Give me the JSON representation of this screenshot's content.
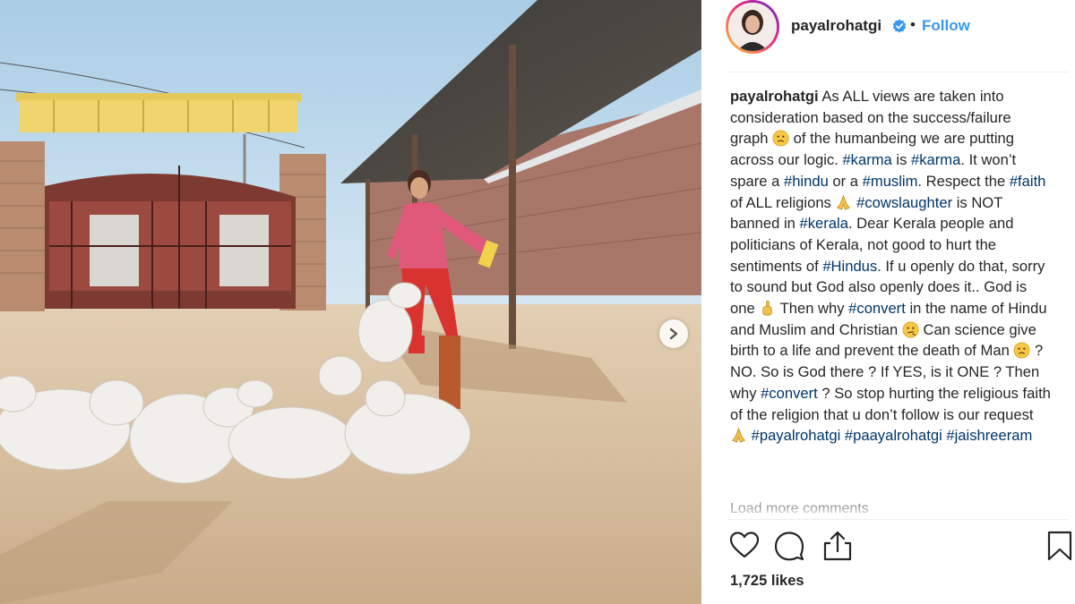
{
  "post": {
    "photo_alt": "",
    "next_button": "chevron-right-icon"
  },
  "header": {
    "username": "payalrohatgi",
    "separator": "•",
    "follow_label": "Follow",
    "verified_icon": "verified-badge-icon"
  },
  "caption": {
    "segments": [
      {
        "t": "user",
        "v": "payalrohatgi"
      },
      {
        "t": "text",
        "v": " As ALL views are taken into consideration based on the success/failure graph "
      },
      {
        "t": "emoji",
        "v": "slightly-frowning"
      },
      {
        "t": "text",
        "v": " of the humanbeing we are putting across our logic. "
      },
      {
        "t": "tag",
        "v": "#karma"
      },
      {
        "t": "text",
        "v": " is "
      },
      {
        "t": "tag",
        "v": "#karma"
      },
      {
        "t": "text",
        "v": ". It won’t spare a "
      },
      {
        "t": "tag",
        "v": "#hindu"
      },
      {
        "t": "text",
        "v": " or a "
      },
      {
        "t": "tag",
        "v": "#muslim"
      },
      {
        "t": "text",
        "v": ". Respect the "
      },
      {
        "t": "tag",
        "v": "#faith"
      },
      {
        "t": "text",
        "v": " of ALL religions "
      },
      {
        "t": "emoji",
        "v": "folded-hands"
      },
      {
        "t": "text",
        "v": " "
      },
      {
        "t": "tag",
        "v": "#cowslaughter"
      },
      {
        "t": "text",
        "v": " is NOT banned in "
      },
      {
        "t": "tag",
        "v": "#kerala"
      },
      {
        "t": "text",
        "v": ". Dear Kerala people and politicians of Kerala, not good to hurt the sentiments of "
      },
      {
        "t": "tag",
        "v": "#Hindus"
      },
      {
        "t": "text",
        "v": ". If u openly do that, sorry to sound but God also openly does it.. God is one "
      },
      {
        "t": "emoji",
        "v": "index-pointing-up"
      },
      {
        "t": "text",
        "v": " Then why "
      },
      {
        "t": "tag",
        "v": "#convert"
      },
      {
        "t": "text",
        "v": " in the name of Hindu and Muslim and Christian "
      },
      {
        "t": "emoji",
        "v": "confused"
      },
      {
        "t": "text",
        "v": " Can science give birth to a life and prevent the death of Man "
      },
      {
        "t": "emoji",
        "v": "slightly-frowning"
      },
      {
        "t": "text",
        "v": " ? NO. So is God there ? If YES, is it ONE ? Then why "
      },
      {
        "t": "tag",
        "v": "#convert"
      },
      {
        "t": "text",
        "v": " ? So stop hurting the religious faith of the religion that u don’t follow is our request "
      },
      {
        "t": "emoji",
        "v": "folded-hands"
      },
      {
        "t": "text",
        "v": " "
      },
      {
        "t": "tag",
        "v": "#payalrohatgi"
      },
      {
        "t": "text",
        "v": " "
      },
      {
        "t": "tag",
        "v": "#paayalrohatgi"
      },
      {
        "t": "text",
        "v": " "
      },
      {
        "t": "tag",
        "v": "#jaishreeram"
      }
    ],
    "load_more_label": "Load more comments"
  },
  "actions": {
    "like_icon": "heart-icon",
    "comment_icon": "comment-icon",
    "share_icon": "share-icon",
    "save_icon": "bookmark-icon"
  },
  "likes": {
    "label": "1,725 likes"
  },
  "colors": {
    "link_blue": "#3897f0",
    "hashtag": "#003569",
    "text": "#262626",
    "muted": "#999999"
  }
}
